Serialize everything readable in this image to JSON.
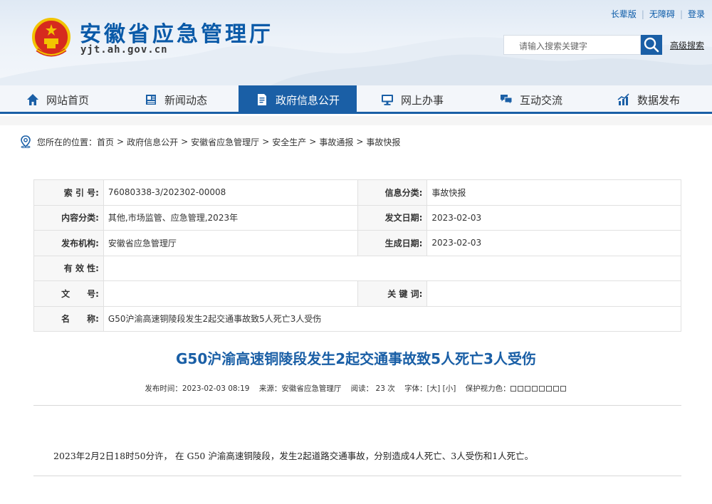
{
  "header": {
    "site_title": "安徽省应急管理厅",
    "site_domain": "yjt.ah.gov.cn",
    "toplinks": [
      "长辈版",
      "无障碍",
      "登录"
    ],
    "search_placeholder": "请输入搜索关键字",
    "advanced_search": "高级搜索"
  },
  "nav": {
    "items": [
      {
        "label": "网站首页",
        "icon": "home-icon"
      },
      {
        "label": "新闻动态",
        "icon": "newspaper-icon"
      },
      {
        "label": "政府信息公开",
        "icon": "document-icon",
        "active": true
      },
      {
        "label": "网上办事",
        "icon": "monitor-icon"
      },
      {
        "label": "互动交流",
        "icon": "chat-icon"
      },
      {
        "label": "数据发布",
        "icon": "chart-icon"
      }
    ],
    "accent_color": "#1a5fa6"
  },
  "breadcrumb": {
    "prefix": "您所在的位置：",
    "items": [
      "首页",
      "政府信息公开",
      "安徽省应急管理厅",
      "安全生产",
      "事故通报",
      "事故快报"
    ],
    "separator": ">"
  },
  "meta": {
    "index_label": "索 引 号:",
    "index_value": "76080338-3/202302-00008",
    "category_label": "信息分类:",
    "category_value": "事故快报",
    "content_label": "内容分类:",
    "content_value": "其他,市场监管、应急管理,2023年",
    "issue_date_label": "发文日期:",
    "issue_date_value": "2023-02-03",
    "publisher_label": "发布机构:",
    "publisher_value": "安徽省应急管理厅",
    "gen_date_label": "生成日期:",
    "gen_date_value": "2023-02-03",
    "validity_label": "有 效 性:",
    "doc_no_label": "文　　号:",
    "keywords_label": "关 键 词:",
    "name_label": "名　　称:",
    "name_value": "G50沪渝高速铜陵段发生2起交通事故致5人死亡3人受伤"
  },
  "article": {
    "title": "G50沪渝高速铜陵段发生2起交通事故致5人死亡3人受伤",
    "publish_time": "发布时间：2023-02-03 08:19",
    "source": "来源：安徽省应急管理厅",
    "views": "阅读：  23  次",
    "font_size": "字体：[大] [小]",
    "eye_care": "保护视力色：",
    "body": "2023年2月2日18时50分许， 在 G50 沪渝高速铜陵段，发生2起道路交通事故，分别造成4人死亡、3人受伤和1人死亡。"
  }
}
